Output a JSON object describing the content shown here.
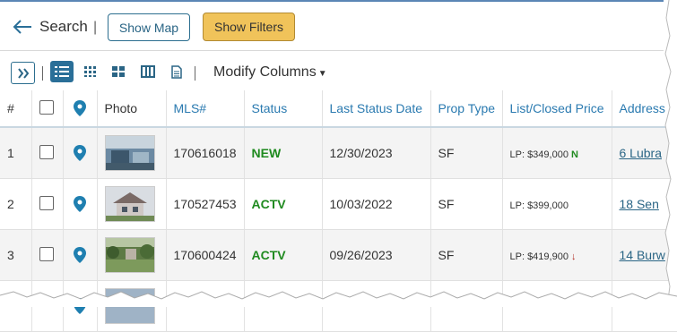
{
  "header": {
    "back_label": "Search",
    "show_map_label": "Show Map",
    "show_filters_label": "Show Filters",
    "separator": "|"
  },
  "toolbar": {
    "expand_icon": "double-chevron-right-icon",
    "modify_columns_label": "Modify Columns",
    "views": [
      "list-view-icon",
      "grid-small-icon",
      "grid-large-icon",
      "columns-icon",
      "document-icon"
    ]
  },
  "table": {
    "columns": [
      "#",
      "",
      "",
      "Photo",
      "MLS#",
      "Status",
      "Last Status Date",
      "Prop Type",
      "List/Closed Price",
      "Address"
    ],
    "rows": [
      {
        "num": "1",
        "mls": "170616018",
        "status": "NEW",
        "date": "12/30/2023",
        "type": "SF",
        "price": "LP: $349,000",
        "badge": "N",
        "address": "6 Lubra"
      },
      {
        "num": "2",
        "mls": "170527453",
        "status": "ACTV",
        "date": "10/03/2022",
        "type": "SF",
        "price": "LP: $399,000",
        "badge": "",
        "address": "18 Sen"
      },
      {
        "num": "3",
        "mls": "170600424",
        "status": "ACTV",
        "date": "09/26/2023",
        "type": "SF",
        "price": "LP: $419,900",
        "badge": "↓",
        "address": "14 Burw"
      }
    ]
  },
  "colors": {
    "accent": "#2a6f98",
    "status_green": "#1f8a1f",
    "filter_button": "#f0c35a",
    "link_header": "#2a7ab0"
  }
}
